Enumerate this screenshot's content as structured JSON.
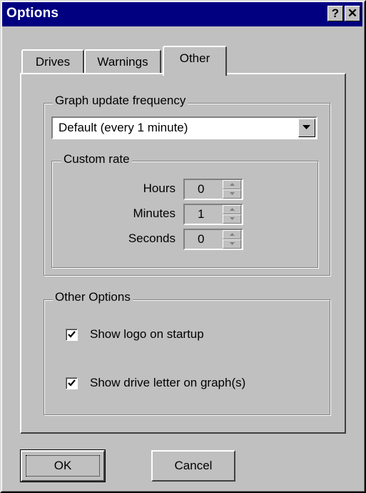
{
  "window": {
    "title": "Options",
    "help_button": "?",
    "close_button": "✕"
  },
  "tabs": [
    {
      "label": "Drives"
    },
    {
      "label": "Warnings"
    },
    {
      "label": "Other",
      "active": true
    }
  ],
  "graph_update": {
    "group_title": "Graph update frequency",
    "selected": "Default (every 1 minute)"
  },
  "custom_rate": {
    "group_title": "Custom rate",
    "fields": [
      {
        "label": "Hours",
        "value": "0"
      },
      {
        "label": "Minutes",
        "value": "1"
      },
      {
        "label": "Seconds",
        "value": "0"
      }
    ]
  },
  "other_options": {
    "group_title": "Other Options",
    "items": [
      {
        "label": "Show logo on startup",
        "checked": true
      },
      {
        "label": "Show drive letter on graph(s)",
        "checked": true
      }
    ]
  },
  "buttons": {
    "ok": "OK",
    "cancel": "Cancel"
  }
}
